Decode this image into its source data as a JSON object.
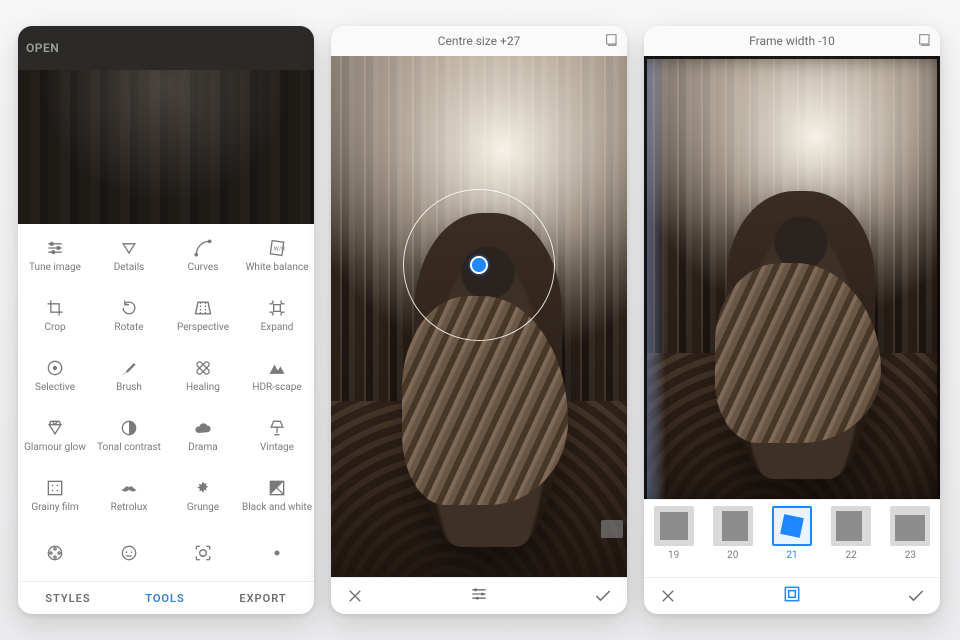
{
  "phone1": {
    "open_label": "OPEN",
    "bottom_tabs": {
      "styles": "STYLES",
      "tools": "TOOLS",
      "export": "EXPORT"
    },
    "tools": [
      {
        "id": "tune-image",
        "label": "Tune image",
        "icon": "sliders"
      },
      {
        "id": "details",
        "label": "Details",
        "icon": "triangle-down"
      },
      {
        "id": "curves",
        "label": "Curves",
        "icon": "curves"
      },
      {
        "id": "white-balance",
        "label": "White balance",
        "icon": "wb-card"
      },
      {
        "id": "crop",
        "label": "Crop",
        "icon": "crop"
      },
      {
        "id": "rotate",
        "label": "Rotate",
        "icon": "rotate"
      },
      {
        "id": "perspective",
        "label": "Perspective",
        "icon": "perspective"
      },
      {
        "id": "expand",
        "label": "Expand",
        "icon": "expand"
      },
      {
        "id": "selective",
        "label": "Selective",
        "icon": "target-dot"
      },
      {
        "id": "brush",
        "label": "Brush",
        "icon": "brush"
      },
      {
        "id": "healing",
        "label": "Healing",
        "icon": "bandage"
      },
      {
        "id": "hdr-scape",
        "label": "HDR-scape",
        "icon": "mountains"
      },
      {
        "id": "glamour-glow",
        "label": "Glamour glow",
        "icon": "diamond"
      },
      {
        "id": "tonal-contrast",
        "label": "Tonal contrast",
        "icon": "half-circle"
      },
      {
        "id": "drama",
        "label": "Drama",
        "icon": "cloud"
      },
      {
        "id": "vintage",
        "label": "Vintage",
        "icon": "lamp"
      },
      {
        "id": "grainy-film",
        "label": "Grainy film",
        "icon": "film-dots"
      },
      {
        "id": "retrolux",
        "label": "Retrolux",
        "icon": "moustache"
      },
      {
        "id": "grunge",
        "label": "Grunge",
        "icon": "splatter"
      },
      {
        "id": "black-and-white",
        "label": "Black and white",
        "icon": "bw-square"
      },
      {
        "id": "noir",
        "label": "",
        "icon": "reel"
      },
      {
        "id": "portrait",
        "label": "",
        "icon": "face"
      },
      {
        "id": "face-enhance",
        "label": "",
        "icon": "face-box"
      },
      {
        "id": "lens-blur",
        "label": "",
        "icon": "dot"
      }
    ]
  },
  "phone2": {
    "status_text": "Centre size +27",
    "slider_param": "Centre size",
    "slider_value": 27
  },
  "phone3": {
    "status_text": "Frame width -10",
    "slider_param": "Frame width",
    "slider_value": -10,
    "frames": [
      {
        "id": "19",
        "label": "19"
      },
      {
        "id": "20",
        "label": "20"
      },
      {
        "id": "21",
        "label": "21",
        "selected": true
      },
      {
        "id": "22",
        "label": "22"
      },
      {
        "id": "23",
        "label": "23"
      }
    ]
  },
  "colors": {
    "accent": "#1f87ff",
    "muted": "#7a7a7a"
  }
}
